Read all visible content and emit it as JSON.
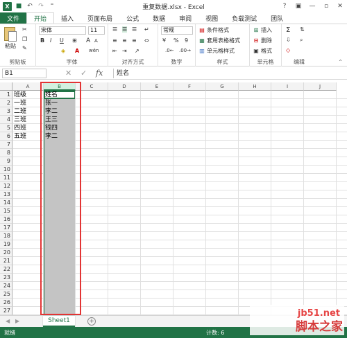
{
  "window": {
    "title": "重复数据.xlsx - Excel",
    "help": "?",
    "minimize": "—",
    "restore": "▫",
    "close": "✕"
  },
  "tabs": [
    "文件",
    "开始",
    "插入",
    "页面布局",
    "公式",
    "数据",
    "审阅",
    "视图",
    "负载测试",
    "团队"
  ],
  "ribbon": {
    "clipboard": {
      "paste": "粘贴",
      "label": "剪贴板"
    },
    "font": {
      "name": "宋体",
      "size": "11",
      "bold": "B",
      "italic": "I",
      "underline": "U",
      "grow": "A",
      "shrink": "A",
      "label": "字体",
      "font_color_glyph": "A",
      "wen": "wén"
    },
    "alignment": {
      "label": "对齐方式"
    },
    "number": {
      "format": "常规",
      "percent": "%",
      "comma": "9",
      "label": "数字"
    },
    "styles": {
      "conditional": "条件格式",
      "table": "套用表格格式",
      "cell": "单元格样式",
      "label": "样式"
    },
    "cells": {
      "insert": "插入",
      "delete": "删除",
      "format": "格式",
      "label": "单元格"
    },
    "editing": {
      "sum": "Σ",
      "label": "编辑"
    }
  },
  "formula_bar": {
    "name_box": "B1",
    "cancel": "✕",
    "enter": "✓",
    "fx": "fx",
    "value": "姓名"
  },
  "grid": {
    "columns": [
      "A",
      "B",
      "C",
      "D",
      "E",
      "F",
      "G",
      "H",
      "I",
      "J"
    ],
    "rows": [
      "1",
      "2",
      "3",
      "4",
      "5",
      "6",
      "7",
      "8",
      "9",
      "10",
      "11",
      "12",
      "13",
      "14",
      "15",
      "16",
      "17",
      "18",
      "19",
      "20",
      "21",
      "22",
      "23",
      "24",
      "25",
      "26",
      "27"
    ],
    "colA": [
      "班级",
      "一班",
      "二班",
      "三班",
      "四班",
      "五班"
    ],
    "colB": [
      "姓名",
      "张一",
      "李二",
      "王三",
      "钱四",
      "李二"
    ]
  },
  "sheets": {
    "active": "Sheet1",
    "add": "+",
    "prev": "◀",
    "next": "▶"
  },
  "status": {
    "ready": "就绪",
    "count": "计数: 6"
  },
  "watermark": {
    "url": "jb51.net",
    "name": "脚本之家"
  },
  "colors": {
    "excel_green": "#217346",
    "selection_gray": "#c4c4c4",
    "highlight_red": "#e23434"
  }
}
